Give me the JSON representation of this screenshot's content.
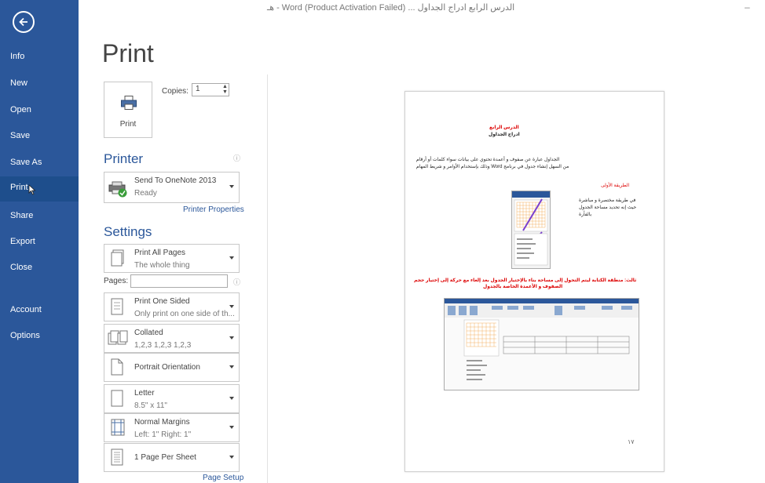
{
  "window": {
    "title": "هـ - Word (Product Activation Failed) ... الدرس الرابع ادراج الجداول",
    "minimize_glyph": "‒"
  },
  "sidebar": {
    "items": [
      {
        "label": "Info"
      },
      {
        "label": "New"
      },
      {
        "label": "Open"
      },
      {
        "label": "Save"
      },
      {
        "label": "Save As"
      },
      {
        "label": "Print"
      },
      {
        "label": "Share"
      },
      {
        "label": "Export"
      },
      {
        "label": "Close"
      },
      {
        "label": "Account"
      },
      {
        "label": "Options"
      }
    ],
    "active": "Print",
    "colors": {
      "background": "#2b579a",
      "active": "#1e4e8c"
    }
  },
  "main": {
    "title": "Print",
    "print_button_label": "Print",
    "copies_label": "Copies:",
    "copies_value": "1",
    "printer": {
      "heading": "Printer",
      "info_glyph": "ⓘ",
      "name": "Send To OneNote 2013",
      "status": "Ready",
      "properties_link": "Printer Properties"
    },
    "settings": {
      "heading": "Settings",
      "pages_label": "Pages:",
      "pages_value": "",
      "info_glyph": "ⓘ",
      "items": [
        {
          "title": "Print All Pages",
          "subtitle": "The whole thing"
        },
        {
          "title": "Print One Sided",
          "subtitle": "Only print on one side of th..."
        },
        {
          "title": "Collated",
          "subtitle": "1,2,3   1,2,3   1,2,3"
        },
        {
          "title": "Portrait Orientation",
          "subtitle": ""
        },
        {
          "title": "Letter",
          "subtitle": "8.5\" x 11\""
        },
        {
          "title": "Normal Margins",
          "subtitle": "Left: 1\"   Right: 1\""
        },
        {
          "title": "1 Page Per Sheet",
          "subtitle": ""
        }
      ],
      "page_setup_link": "Page Setup"
    }
  },
  "preview": {
    "heading_red": "الدرس الرابع",
    "heading_black": "ادراج الجداول",
    "para_line1": "الجداول عبارة عن صفوف و أعمدة تحتوي على بيانات سواء كلمات أو أرقام",
    "para_line2": "من السهل إنشاء جدول في برنامج Word وذلك بإستخدام الأوامر و شريط المهام",
    "subheading": "الطريقة الأولى",
    "method_line1": "في طريقة مختصرة و مباشرة",
    "method_line2": "حيث إنه تحديد مساحة الجدول",
    "method_line3": "بالفأرة",
    "red_note_line1": "ثالث: منطقة الكتابة ليتم التحول إلى مساحة بناء بالإختيار الجدول بعد إلغاء مع حركة إلى إختيار حجم",
    "red_note_line2": "الصفوف و الأعمدة الخاصة بالجدول",
    "page_number": "١٧"
  }
}
